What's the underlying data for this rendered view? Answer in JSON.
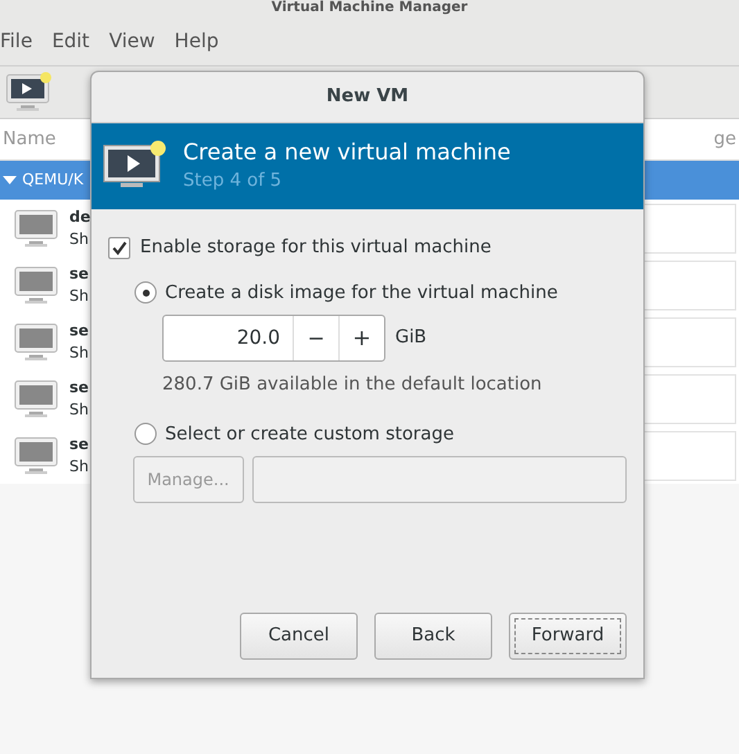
{
  "window": {
    "title": "Virtual Machine Manager"
  },
  "menu": [
    "File",
    "Edit",
    "View",
    "Help"
  ],
  "list": {
    "columns": [
      "Name",
      "ge"
    ],
    "host": {
      "label": "QEMU/K",
      "expanded": true
    },
    "vms": [
      {
        "name": "de",
        "status": "Sh"
      },
      {
        "name": "se",
        "status": "Sh"
      },
      {
        "name": "se",
        "status": "Sh"
      },
      {
        "name": "se",
        "status": "Sh"
      },
      {
        "name": "se",
        "status": "Sh"
      }
    ]
  },
  "dialog": {
    "title": "New VM",
    "header": {
      "title": "Create a new virtual machine",
      "step": "Step 4 of 5"
    },
    "enable_storage": {
      "label": "Enable storage for this virtual machine",
      "checked": true
    },
    "options": [
      {
        "label": "Create a disk image for the virtual machine",
        "selected": true
      },
      {
        "label": "Select or create custom storage",
        "selected": false
      }
    ],
    "size": {
      "value": "20.0",
      "decrement": "−",
      "increment": "+",
      "unit": "GiB"
    },
    "available": "280.7 GiB available in the default location",
    "manage_button": {
      "label": "Manage...",
      "disabled": true
    },
    "buttons": [
      {
        "label": "Cancel",
        "focused": false
      },
      {
        "label": "Back",
        "focused": false
      },
      {
        "label": "Forward",
        "focused": true
      }
    ]
  }
}
